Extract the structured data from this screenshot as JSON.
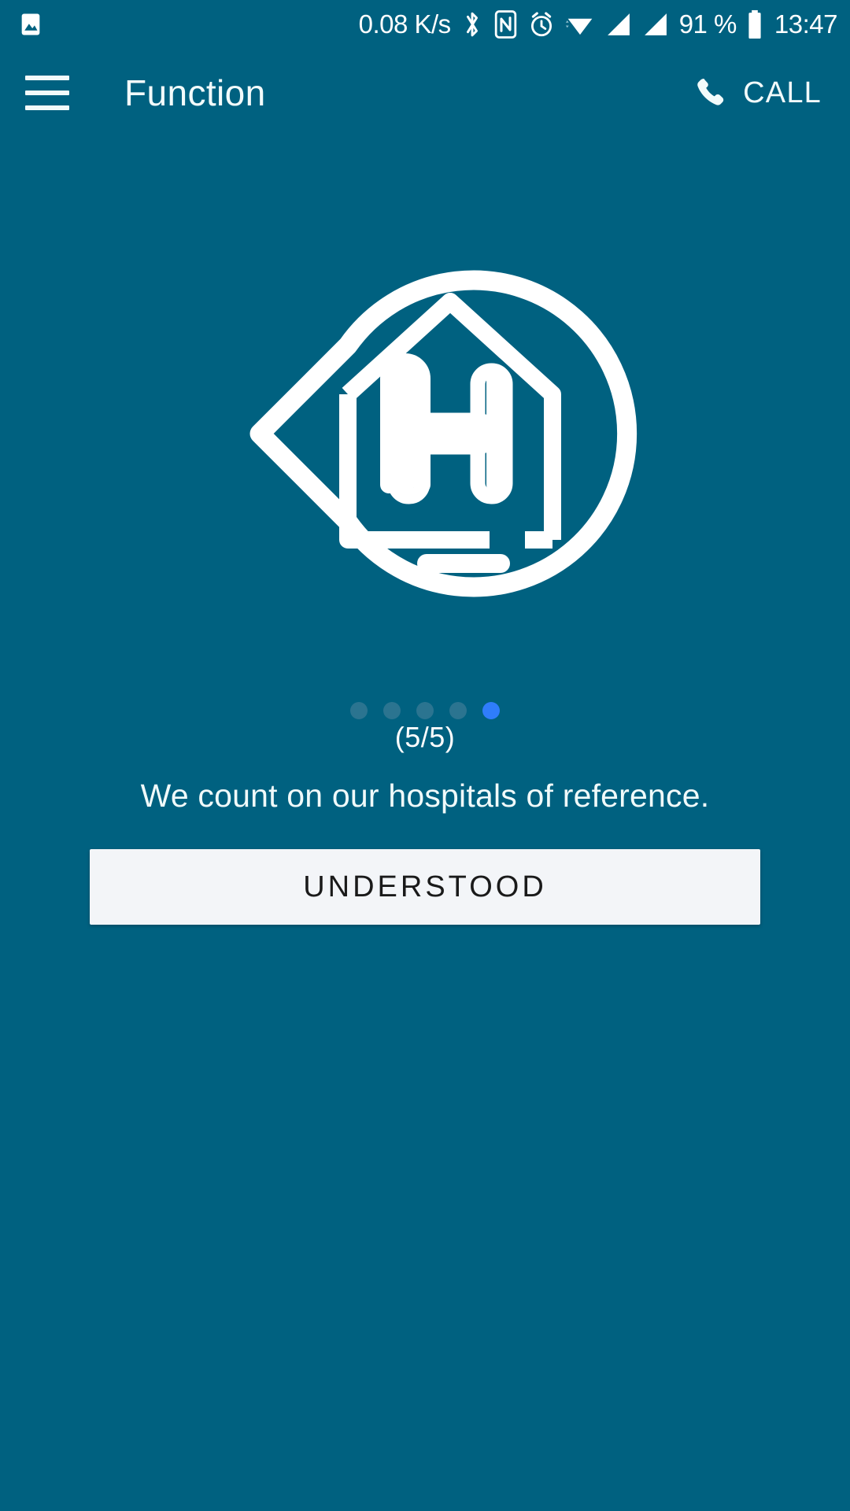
{
  "theme": {
    "background": "#006180",
    "appbar": "#006180",
    "on_primary": "#f2fbfb",
    "button_bg": "#f3f5f8",
    "button_text": "#1a1a1a",
    "dot_inactive": "#2b7490",
    "dot_active": "#2f7dfb"
  },
  "status_bar": {
    "left_icon": "image-icon",
    "network_speed": "0.08 K/s",
    "icons": [
      "bluetooth-icon",
      "nfc-icon",
      "alarm-icon",
      "wifi-icon",
      "signal-sim1-icon",
      "signal-sim2-icon"
    ],
    "battery_percent": "91 %",
    "battery_icon": "battery-icon",
    "clock": "13:47"
  },
  "app_bar": {
    "menu_icon": "hamburger-menu-icon",
    "title": "Function",
    "call": {
      "icon": "phone-call-icon",
      "label": "CALL"
    }
  },
  "main": {
    "logo": "hospital-location-pin-logo",
    "step_counter": "(5/5)",
    "message": "We count on our hospitals of reference.",
    "cta_label": "UNDERSTOOD",
    "pager": {
      "total": 5,
      "active_index": 4,
      "dots": [
        "1",
        "2",
        "3",
        "4",
        "5"
      ]
    }
  }
}
